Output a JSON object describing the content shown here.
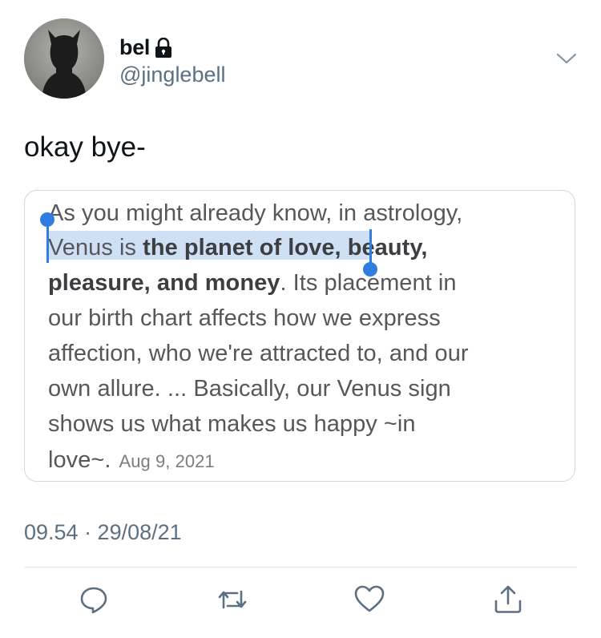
{
  "user": {
    "name": "bel",
    "handle": "@jinglebell"
  },
  "tweet": {
    "text": "okay bye-",
    "timestamp": "09.54 · 29/08/21"
  },
  "quote": {
    "lines": [
      {
        "pre": "As you might already know, in astrology,",
        "bold": "",
        "post": ""
      },
      {
        "pre": "Venus is ",
        "bold": "the planet of love, beauty,",
        "post": ""
      },
      {
        "pre": "",
        "bold": "pleasure, and money",
        "post": ". Its placement in"
      },
      {
        "pre": "our birth chart affects how we express",
        "bold": "",
        "post": ""
      },
      {
        "pre": "affection, who we're attracted to, and our",
        "bold": "",
        "post": ""
      },
      {
        "pre": "own allure. ... Basically, our Venus sign",
        "bold": "",
        "post": ""
      },
      {
        "pre": "shows us what makes us happy ~in",
        "bold": "",
        "post": ""
      },
      {
        "pre": "love~.",
        "bold": "",
        "post": ""
      }
    ],
    "date": "Aug 9, 2021",
    "selected_text": "Venus is the planet of love"
  },
  "icons": {
    "lock": "lock-icon",
    "more": "chevron-down-icon",
    "reply": "reply-icon",
    "retweet": "retweet-icon",
    "like": "heart-icon",
    "share": "share-icon"
  },
  "colors": {
    "selection": "#cfe0f4",
    "selection_handle": "#2f7de1",
    "secondary_text": "#5b7083"
  }
}
